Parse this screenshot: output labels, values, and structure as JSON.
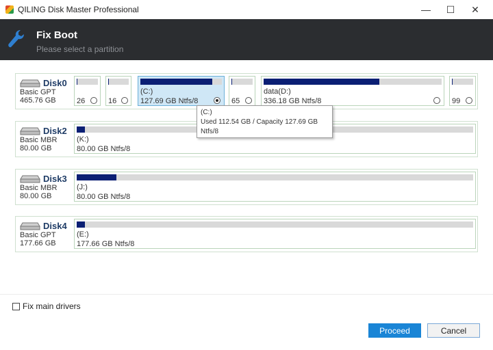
{
  "window": {
    "title": "QILING Disk Master Professional",
    "minimize": "—",
    "maximize": "☐",
    "close": "✕"
  },
  "header": {
    "title": "Fix Boot",
    "subtitle": "Please select a partition"
  },
  "disks": [
    {
      "name": "Disk0",
      "type": "Basic GPT",
      "size": "465.76 GB",
      "partitions": [
        {
          "label": "",
          "size": "26",
          "used_fraction": 0.04,
          "selected": false
        },
        {
          "label": "",
          "size": "16",
          "used_fraction": 0.04,
          "selected": false
        },
        {
          "label": "(C:)",
          "size": "127.69 GB Ntfs/8",
          "used_fraction": 0.88,
          "selected": true
        },
        {
          "label": "",
          "size": "65",
          "used_fraction": 0.04,
          "selected": false
        },
        {
          "label": "data(D:)",
          "size": "336.18 GB Ntfs/8",
          "used_fraction": 0.65,
          "selected": false
        },
        {
          "label": "",
          "size": "99",
          "used_fraction": 0.04,
          "selected": false
        }
      ]
    },
    {
      "name": "Disk2",
      "type": "Basic MBR",
      "size": "80.00 GB",
      "partitions": [
        {
          "label": "(K:)",
          "size": "80.00 GB Ntfs/8",
          "used_fraction": 0.01,
          "selected": false
        }
      ]
    },
    {
      "name": "Disk3",
      "type": "Basic MBR",
      "size": "80.00 GB",
      "partitions": [
        {
          "label": "(J:)",
          "size": "80.00 GB Ntfs/8",
          "used_fraction": 0.1,
          "selected": false
        }
      ]
    },
    {
      "name": "Disk4",
      "type": "Basic GPT",
      "size": "177.66 GB",
      "partitions": [
        {
          "label": "(E:)",
          "size": "177.66 GB Ntfs/8",
          "used_fraction": 0.01,
          "selected": false
        }
      ]
    }
  ],
  "tooltip": {
    "line1": "(C:)",
    "line2": "Used 112.54 GB / Capacity 127.69 GB",
    "line3": "Ntfs/8"
  },
  "options": {
    "fix_main_drivers": "Fix main drivers",
    "fix_main_drivers_checked": false
  },
  "buttons": {
    "proceed": "Proceed",
    "cancel": "Cancel"
  },
  "colors": {
    "header_bg": "#2b2d30",
    "used_bar": "#0b1f74",
    "accent": "#1a85d6",
    "selected_bg": "#cfe7f6"
  }
}
